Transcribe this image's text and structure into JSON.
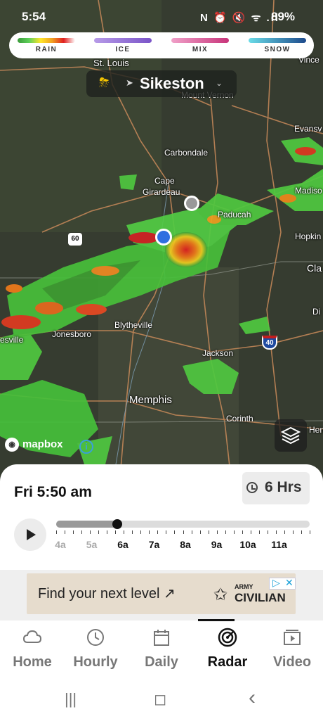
{
  "status_bar": {
    "time": "5:54",
    "icons": "N ⏰ 🔇 ᯤ .ıl",
    "battery": "89%"
  },
  "legend": [
    {
      "label": "RAIN",
      "gradient": "linear-gradient(90deg,#3a9a3a,#5ed05a,#ffe62a,#f0a020,#e02020,#ffffff)"
    },
    {
      "label": "ICE",
      "gradient": "linear-gradient(90deg,#b79be8,#7a54c8)"
    },
    {
      "label": "MIX",
      "gradient": "linear-gradient(90deg,#f0a0c8,#c8347a)"
    },
    {
      "label": "SNOW",
      "gradient": "linear-gradient(90deg,#6adce8,#1d4a8c)"
    }
  ],
  "location": {
    "name": "Sikeston",
    "bolt_icon": "lightning-cloud-icon",
    "nav_icon": "location-arrow-icon"
  },
  "cities": {
    "st_louis": "St. Louis",
    "vincennes": "Vince",
    "mount_vernon": "Mount Vernon",
    "evansville": "Evansv",
    "carbondale": "Carbondale",
    "cape": "Cape",
    "girardeau": "Girardeau",
    "madisonville": "Madiso",
    "paducah": "Paducah",
    "hopkinsville": "Hopkin",
    "clarksville": "Cla",
    "dickson": "Di",
    "blytheville": "Blytheville",
    "jonesboro": "Jonesboro",
    "batesville": "esville",
    "jackson": "Jackson",
    "memphis": "Memphis",
    "corinth": "Corinth",
    "henderson": "Henc",
    "route_60": "60",
    "route_40": "40"
  },
  "attribution": {
    "brand": "mapbox",
    "info": "i"
  },
  "timeline": {
    "current_time": "Fri 5:50 am",
    "range_label": "6 Hrs",
    "progress": 0.24,
    "hours": [
      {
        "label": "4a",
        "past": true
      },
      {
        "label": "5a",
        "past": true
      },
      {
        "label": "6a",
        "past": false
      },
      {
        "label": "7a",
        "past": false
      },
      {
        "label": "8a",
        "past": false
      },
      {
        "label": "9a",
        "past": false
      },
      {
        "label": "10a",
        "past": false
      },
      {
        "label": "11a",
        "past": false
      }
    ]
  },
  "ad": {
    "headline": "Find your next level ↗",
    "brand_top": "ARMY",
    "brand_main": "CIVILIAN"
  },
  "nav": [
    {
      "label": "Home",
      "icon": "cloud-icon",
      "active": false
    },
    {
      "label": "Hourly",
      "icon": "clock-icon",
      "active": false
    },
    {
      "label": "Daily",
      "icon": "calendar-icon",
      "active": false
    },
    {
      "label": "Radar",
      "icon": "radar-icon",
      "active": true
    },
    {
      "label": "Video",
      "icon": "video-play-icon",
      "active": false
    }
  ],
  "system_nav": {
    "recents": "|||",
    "home": "◻",
    "back": "‹"
  }
}
